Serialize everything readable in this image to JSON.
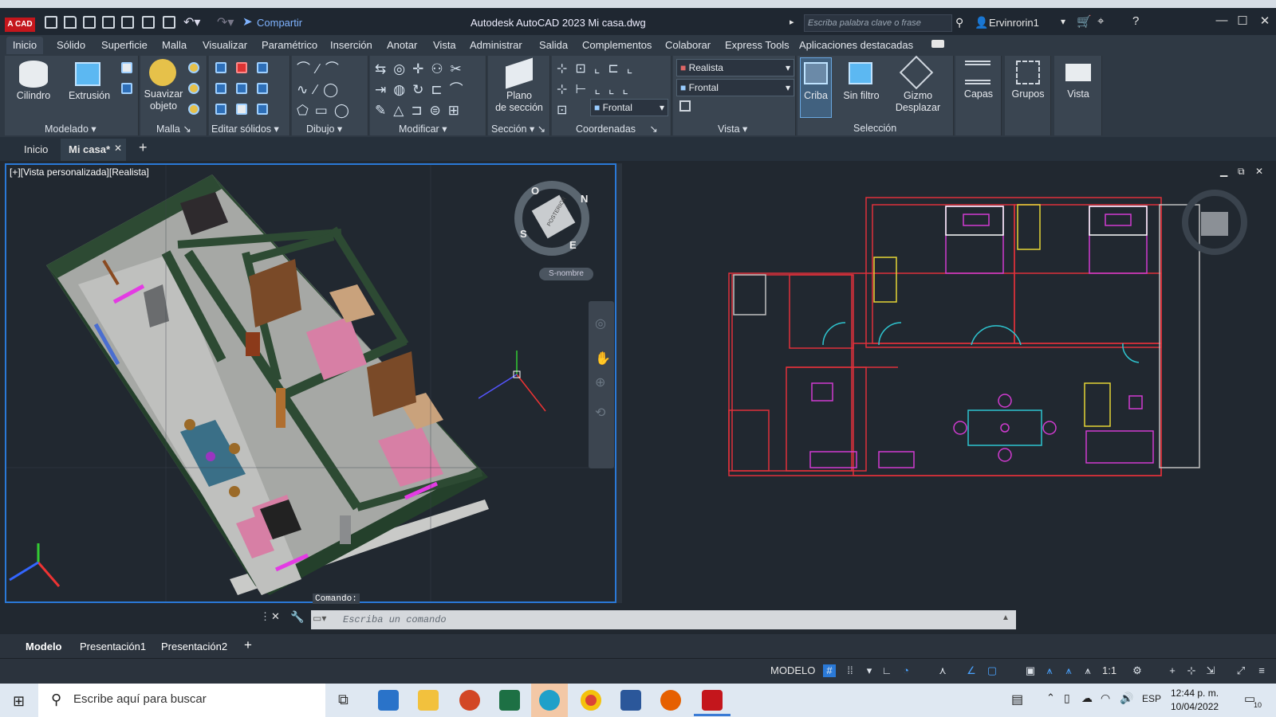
{
  "titlebar": {
    "app_button": "A CAD",
    "share_label": "Compartir",
    "window_title": "Autodesk AutoCAD 2023   Mi casa.dwg",
    "search_placeholder": "Escriba palabra clave o frase",
    "user": "Ervinrorin1"
  },
  "menu_tabs": [
    "Inicio",
    "Sólido",
    "Superficie",
    "Malla",
    "Visualizar",
    "Paramétrico",
    "Inserción",
    "Anotar",
    "Vista",
    "Administrar",
    "Salida",
    "Complementos",
    "Colaborar",
    "Express Tools",
    "Aplicaciones destacadas"
  ],
  "ribbon": {
    "big_buttons": {
      "cilindro": "Cilindro",
      "extrusion": "Extrusión",
      "suavizar": "Suavizar\nobjeto",
      "plano": "Plano\nde sección",
      "criba": "Criba",
      "sin_filtro": "Sin filtro",
      "gizmo": "Gizmo\nDesplazar",
      "capas": "Capas",
      "grupos": "Grupos",
      "vista": "Vista"
    },
    "panels": [
      "Modelado",
      "Malla",
      "Editar sólidos",
      "Dibujo",
      "Modificar",
      "Sección",
      "Coordenadas",
      "Vista",
      "Selección"
    ],
    "visual_style": "Realista",
    "view_name": "Frontal",
    "ucs_name": "Frontal"
  },
  "doc_tabs": {
    "home": "Inicio",
    "active": "Mi casa*"
  },
  "viewport": {
    "label": "[+][Vista personalizada][Realista]",
    "viewcube_label": "POSTERIOR",
    "wcs": "S-nombre",
    "compass": {
      "n": "N",
      "s": "S",
      "e": "E",
      "w": "O"
    }
  },
  "command": {
    "label": "Comando:",
    "placeholder": "Escriba un comando"
  },
  "layout_tabs": [
    "Modelo",
    "Presentación1",
    "Presentación2"
  ],
  "status": {
    "model": "MODELO",
    "scale": "1:1"
  },
  "taskbar": {
    "search": "Escribe aquí para buscar",
    "lang": "ESP",
    "time": "12:44 p. m.",
    "date": "10/04/2022",
    "notifications": "10"
  },
  "colors": {
    "accent": "#2a79d7",
    "wall": "#2d4a33",
    "floor": "#a7a9a6",
    "plan_red": "#e0303a",
    "plan_magenta": "#d13bd1",
    "plan_cyan": "#2ec4cf",
    "plan_yellow": "#e6d636"
  }
}
